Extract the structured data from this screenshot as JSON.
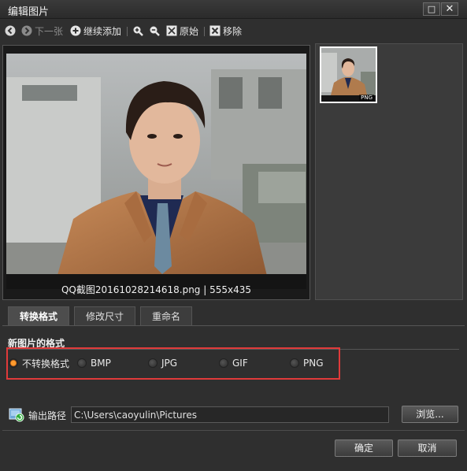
{
  "window": {
    "title": "编辑图片",
    "minimize": "□",
    "close": "✕"
  },
  "toolbar": {
    "prev_label": "",
    "next_label": "下一张",
    "add_label": "继续添加",
    "original_label": "原始",
    "remove_label": "移除",
    "icons": [
      "prev-arrow-icon",
      "next-arrow-icon",
      "add-icon",
      "zoom-in-icon",
      "zoom-out-icon",
      "fit-original-icon",
      "remove-icon"
    ]
  },
  "preview": {
    "caption": "QQ截图20161028214618.png | 555x435"
  },
  "thumbnails": [
    {
      "badge": "PNG",
      "selected": true
    }
  ],
  "tabs": [
    {
      "label": "转换格式",
      "active": true
    },
    {
      "label": "修改尺寸",
      "active": false
    },
    {
      "label": "重命名",
      "active": false
    }
  ],
  "format": {
    "section_title": "新图片的格式",
    "options": [
      {
        "label": "不转换格式",
        "selected": true
      },
      {
        "label": "BMP",
        "selected": false
      },
      {
        "label": "JPG",
        "selected": false
      },
      {
        "label": "GIF",
        "selected": false
      },
      {
        "label": "PNG",
        "selected": false
      }
    ]
  },
  "output": {
    "label": "输出路径",
    "path": "C:\\Users\\caoyulin\\Pictures",
    "browse_label": "浏览..."
  },
  "footer": {
    "ok_label": "确定",
    "cancel_label": "取消"
  },
  "colors": {
    "highlight_box": "#e03a3a",
    "radio_selected": "#ff9b2e",
    "background": "#2f2f2f"
  }
}
